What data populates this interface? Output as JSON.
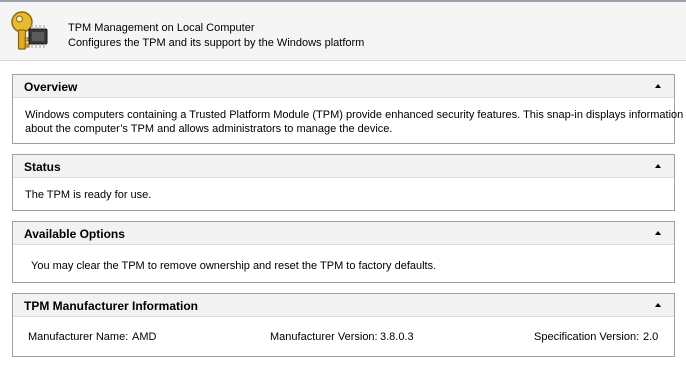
{
  "header": {
    "title": "TPM Management on Local Computer",
    "subtitle": "Configures the TPM and its support by the Windows platform",
    "icon": "tpm-key-chip-icon"
  },
  "sections": {
    "overview": {
      "title": "Overview",
      "line1": "Windows computers containing a Trusted Platform Module (TPM) provide enhanced security features. This snap-in displays information",
      "line2": "about the computer’s TPM and allows administrators to manage the device."
    },
    "status": {
      "title": "Status",
      "text": "The TPM is ready for use."
    },
    "options": {
      "title": "Available Options",
      "text": "You may clear the TPM to remove ownership and reset the TPM to factory defaults."
    },
    "manufacturer": {
      "title": "TPM Manufacturer Information",
      "name_label": "Manufacturer Name:",
      "name_value": "AMD",
      "version_label": "Manufacturer Version:",
      "version_value": "3.8.0.3",
      "spec_label": "Specification Version:",
      "spec_value": "2.0"
    }
  },
  "collapse_icon": "chevron-up-icon",
  "colors": {
    "header_bg": "#f5f5f5",
    "section_border": "#a0a0a0",
    "section_header_bg": "#f2f2f2"
  }
}
